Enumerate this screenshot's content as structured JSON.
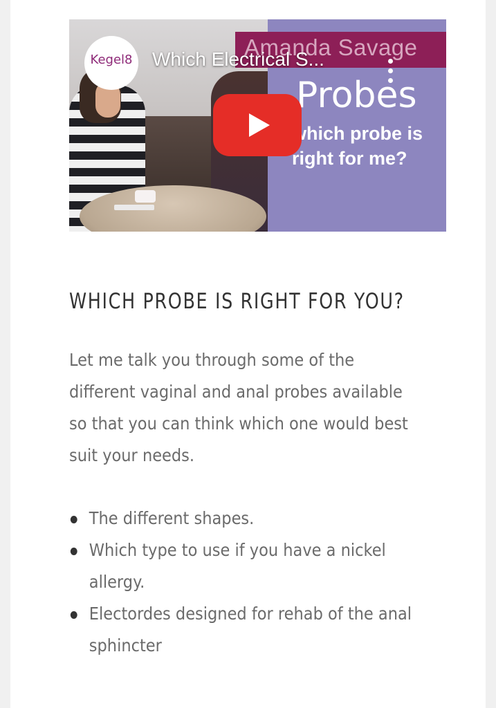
{
  "video": {
    "title_overlay": "Which Electrical S...",
    "logo_text": "Kegel8",
    "presenter_name": "Amanda Savage",
    "slide_heading": "Probes",
    "slide_question": "which probe is\nright for me?",
    "icons": {
      "play": "play-icon",
      "menu": "more-vert-icon"
    },
    "colors": {
      "play_button": "#e52d27",
      "panel": "#8d86bf",
      "name_strip": "#8d1f57"
    }
  },
  "article": {
    "heading": "WHICH PROBE IS RIGHT FOR YOU?",
    "intro": "Let me talk you through some of the different vaginal and anal probes available so that you can think which one would best suit your needs.",
    "bullets": [
      "The different shapes.",
      "Which type to use if you have a nickel allergy.",
      "Electordes designed for rehab of the anal sphincter"
    ]
  }
}
